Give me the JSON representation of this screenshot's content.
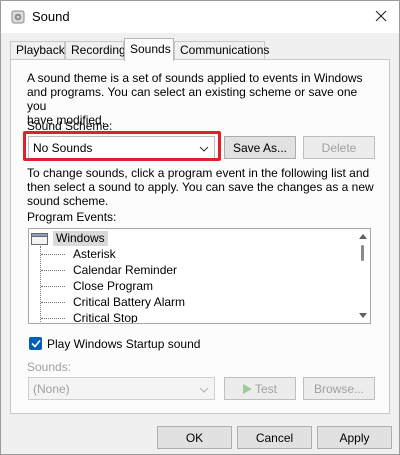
{
  "window": {
    "title": "Sound",
    "icons": {
      "app": "speaker-icon",
      "close": "close-icon"
    }
  },
  "tabs": [
    {
      "label": "Playback",
      "active": false
    },
    {
      "label": "Recording",
      "active": false
    },
    {
      "label": "Sounds",
      "active": true
    },
    {
      "label": "Communications",
      "active": false
    }
  ],
  "sounds": {
    "intro": [
      "A sound theme is a set of sounds applied to events in Windows",
      "and programs.  You can select an existing scheme or save one you",
      "have modified."
    ],
    "scheme_label": "Sound Scheme:",
    "scheme_value": "No Sounds",
    "save_as_label": "Save As...",
    "delete_label": "Delete",
    "change_text": [
      "To change sounds, click a program event in the following list and",
      "then select a sound to apply.  You can save the changes as a new",
      "sound scheme."
    ],
    "events_label": "Program Events:",
    "events_root": "Windows",
    "events": [
      "Asterisk",
      "Calendar Reminder",
      "Close Program",
      "Critical Battery Alarm",
      "Critical Stop"
    ],
    "startup_label": "Play Windows Startup sound",
    "startup_checked": true,
    "sounds_label": "Sounds:",
    "sound_value": "(None)",
    "test_label": "Test",
    "browse_label": "Browse..."
  },
  "footer": {
    "ok_label": "OK",
    "cancel_label": "Cancel",
    "apply_label": "Apply"
  },
  "colors": {
    "accent": "#005fb8",
    "highlight_outline": "#e0202a"
  }
}
